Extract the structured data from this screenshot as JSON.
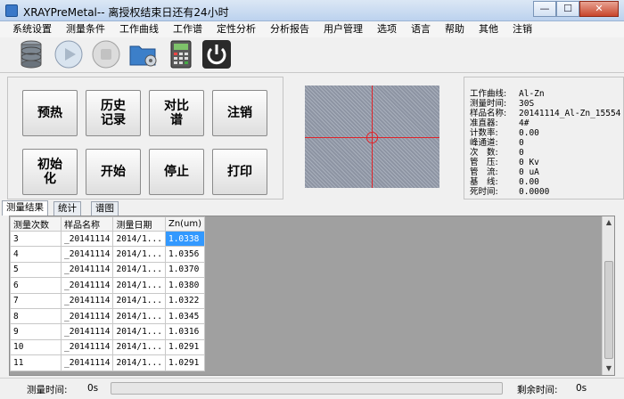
{
  "window": {
    "title": "XRAYPreMetal-- 离授权结束日还有24小时",
    "min_label": "—",
    "max_label": "☐",
    "close_label": "✕"
  },
  "menu": [
    "系统设置",
    "测量条件",
    "工作曲线",
    "工作谱",
    "定性分析",
    "分析报告",
    "用户管理",
    "选项",
    "语言",
    "帮助",
    "其他",
    "注销"
  ],
  "toolbar": {
    "icons": [
      "database-icon",
      "play-icon",
      "stop-icon",
      "folder-settings-icon",
      "calculator-icon",
      "power-icon"
    ]
  },
  "buttons": {
    "preheat": "预热",
    "history": "历史记录",
    "compare": "对比谱",
    "logout": "注销",
    "init": "初始化",
    "start": "开始",
    "stop": "停止",
    "print": "打印"
  },
  "info": [
    {
      "key": "工作曲线:",
      "value": "Al-Zn"
    },
    {
      "key": "测量时间:",
      "value": "30S"
    },
    {
      "key": "样品名称:",
      "value": "20141114_Al-Zn_15554"
    },
    {
      "key": "准直器:",
      "value": "4#"
    },
    {
      "key": "计数率:",
      "value": "0.00"
    },
    {
      "key": "峰通道:",
      "value": "0"
    },
    {
      "key": "次　数:",
      "value": "0"
    },
    {
      "key": "管　压:",
      "value": "0 Kv"
    },
    {
      "key": "管　流:",
      "value": "0 uA"
    },
    {
      "key": "基　线:",
      "value": "0.00"
    },
    {
      "key": "死时间:",
      "value": "0.0000"
    }
  ],
  "tabs": [
    "测量结果",
    "统计",
    "谱图"
  ],
  "table": {
    "headers": [
      "测量次数",
      "样品名称",
      "测量日期",
      "Zn(um)"
    ],
    "rows": [
      [
        "3",
        "_20141114",
        "2014/1...",
        "1.0338"
      ],
      [
        "4",
        "_20141114",
        "2014/1...",
        "1.0356"
      ],
      [
        "5",
        "_20141114",
        "2014/1...",
        "1.0370"
      ],
      [
        "6",
        "_20141114",
        "2014/1...",
        "1.0380"
      ],
      [
        "7",
        "_20141114",
        "2014/1...",
        "1.0322"
      ],
      [
        "8",
        "_20141114",
        "2014/1...",
        "1.0345"
      ],
      [
        "9",
        "_20141114",
        "2014/1...",
        "1.0316"
      ],
      [
        "10",
        "_20141114",
        "2014/1...",
        "1.0291"
      ],
      [
        "11",
        "_20141114",
        "2014/1...",
        "1.0291"
      ]
    ]
  },
  "status": {
    "measure_time_label": "测量时间:",
    "measure_time_value": "0s",
    "remaining_label": "剩余时间:",
    "remaining_value": "0s",
    "progress_fraction": 0
  },
  "colors": {
    "selected_cell": "#3399ff",
    "crosshair": "#e0242a",
    "close_button": "#c8452c"
  }
}
